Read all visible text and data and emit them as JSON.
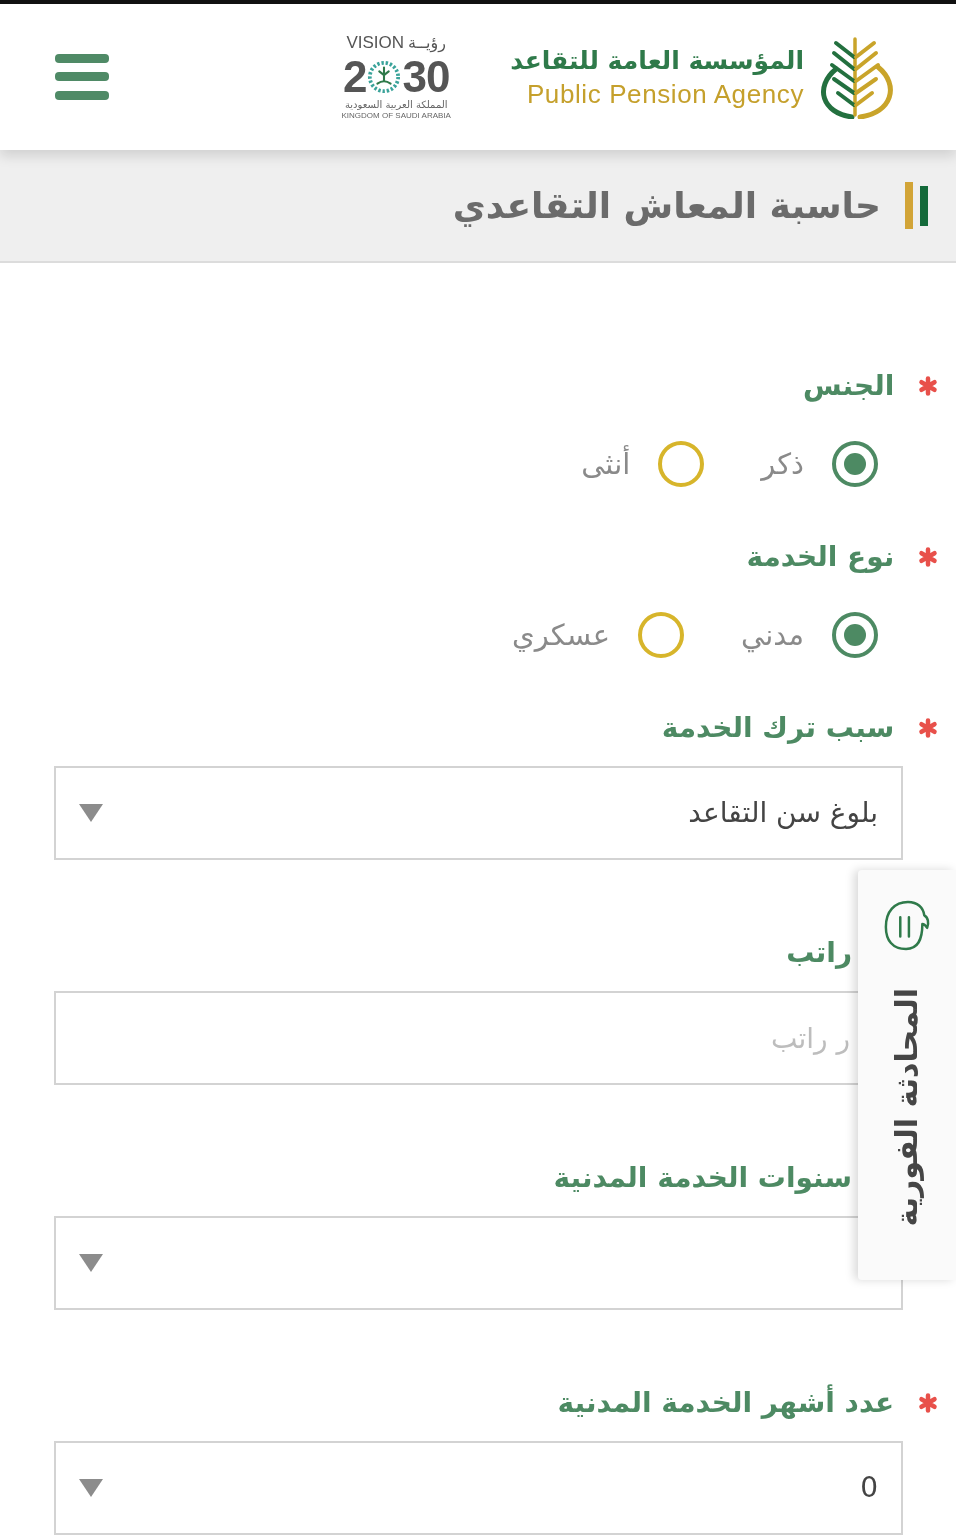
{
  "header": {
    "logo": {
      "arabic_name": "المؤسسة العامة للتقاعد",
      "english_name": "Public Pension Agency"
    },
    "vision_logo": {
      "latin_word": "VISION",
      "arabic_word": "رؤيــة",
      "year_start": "2",
      "year_end": "30",
      "country_arabic": "المملكة العربية السعودية",
      "country_latin": "KINGDOM OF SAUDI ARABIA"
    }
  },
  "page_title": "حاسبة المعاش التقاعدي",
  "fields": [
    {
      "kind": "radio",
      "label": "الجنس",
      "required": true,
      "options": [
        {
          "label": "ذكر",
          "selected": true
        },
        {
          "label": "أنثى",
          "selected": false
        }
      ]
    },
    {
      "kind": "radio",
      "label": "نوع الخدمة",
      "required": true,
      "options": [
        {
          "label": "مدني",
          "selected": true
        },
        {
          "label": "عسكري",
          "selected": false
        }
      ]
    },
    {
      "kind": "select",
      "label": "سبب ترك الخدمة",
      "required": true,
      "value": "بلوغ سن التقاعد"
    },
    {
      "kind": "text",
      "label": "راتب",
      "required": false,
      "placeholder": "ر راتب"
    },
    {
      "kind": "select",
      "label": "سنوات الخدمة المدنية",
      "required": false
    },
    {
      "kind": "select",
      "label": "عدد أشهر الخدمة المدنية",
      "required": true,
      "value": "0"
    }
  ],
  "chat_tab": {
    "label": "المحادثة الفورية"
  }
}
